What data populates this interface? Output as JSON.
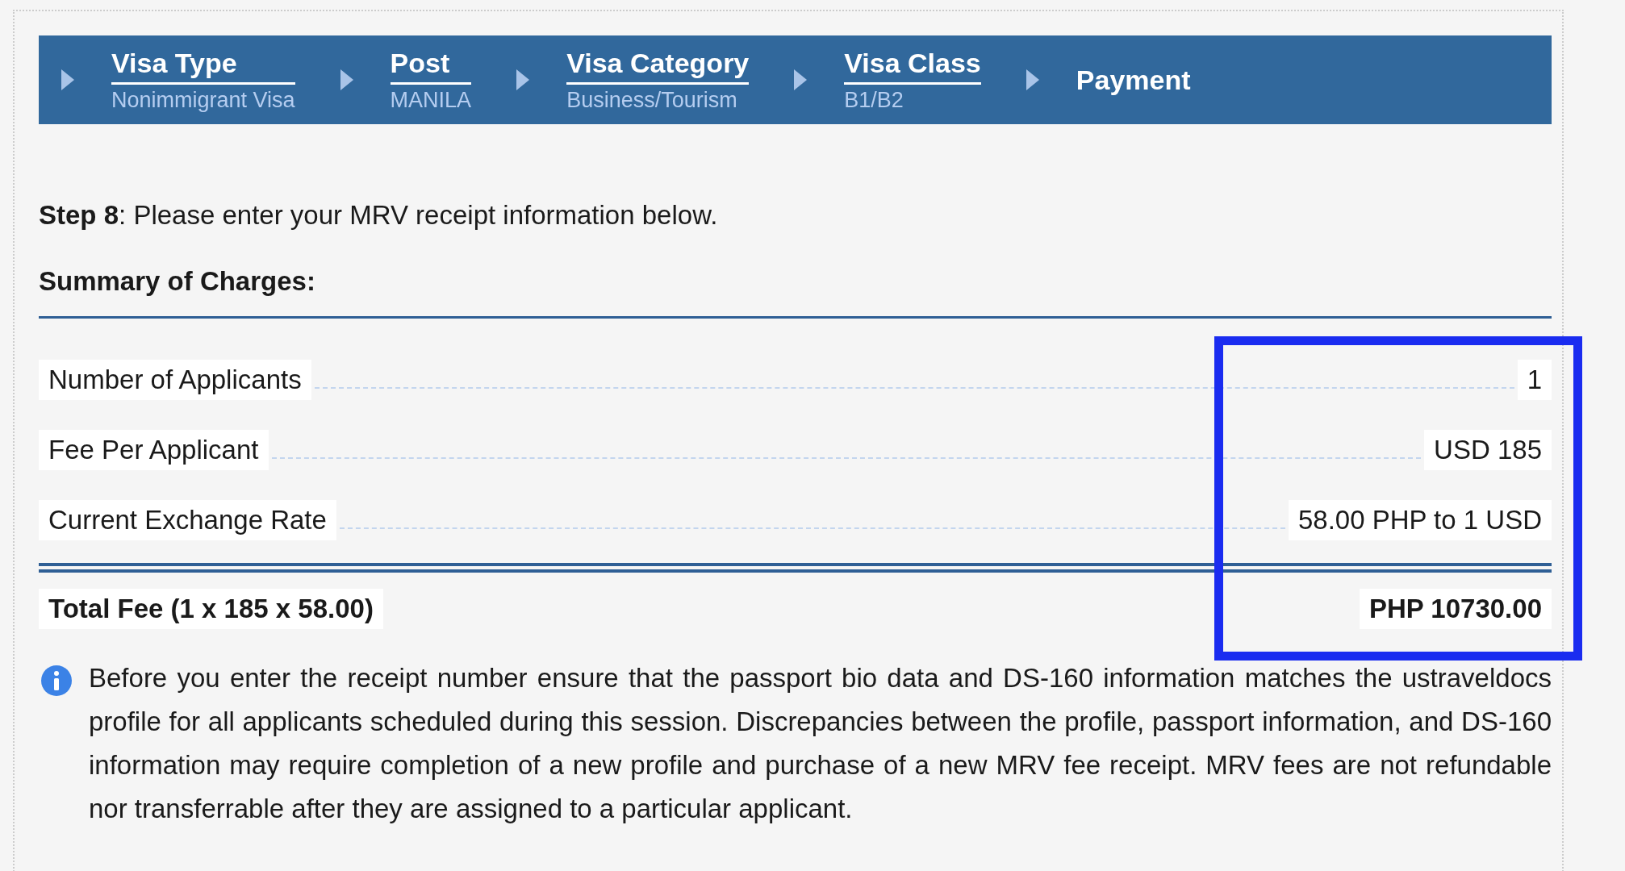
{
  "steps": [
    {
      "kind": "done",
      "title": "Visa Type",
      "value": "Nonimmigrant Visa"
    },
    {
      "kind": "done",
      "title": "Post",
      "value": "MANILA"
    },
    {
      "kind": "done",
      "title": "Visa Category",
      "value": "Business/Tourism"
    },
    {
      "kind": "done",
      "title": "Visa Class",
      "value": "B1/B2"
    },
    {
      "kind": "current",
      "title": "Payment"
    }
  ],
  "instruction": "**Step 8**: Please enter your MRV receipt information below.",
  "summary_heading": "Summary of Charges:",
  "charges": [
    {
      "label": "Number of Applicants",
      "value": "1"
    },
    {
      "label": "Fee Per Applicant",
      "value": "USD 185"
    },
    {
      "label": "Current Exchange Rate",
      "value": "58.00 PHP to 1 USD"
    }
  ],
  "total": {
    "label": "Total Fee (1 x 185 x 58.00)",
    "value": "PHP 10730.00"
  },
  "notice": "Before you enter the receipt number ensure that the passport bio data and DS-160 information matches the ustraveldocs profile for all applicants scheduled during this session. Discrepancies between the profile, passport information, and DS-160 information may require completion of a new profile and purchase of a new MRV fee receipt. MRV fees are not refundable nor transferrable after they are assigned to a particular applicant."
}
